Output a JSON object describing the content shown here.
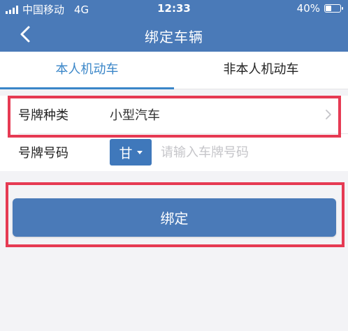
{
  "status_bar": {
    "carrier": "中国移动",
    "network": "4G",
    "time": "12:33",
    "battery": "40%"
  },
  "nav": {
    "title": "绑定车辆",
    "back_icon": "chevron-left-icon"
  },
  "tabs": [
    {
      "label": "本人机动车",
      "active": true
    },
    {
      "label": "非本人机动车",
      "active": false
    }
  ],
  "form": {
    "plate_type_label": "号牌种类",
    "plate_type_value": "小型汽车",
    "plate_number_label": "号牌号码",
    "province": "甘",
    "plate_placeholder": "请输入车牌号码"
  },
  "bind_button": "绑定",
  "colors": {
    "primary": "#4a7ab8",
    "tab_active": "#3a86c8",
    "highlight": "#e63a53",
    "background": "#f3f3f6"
  }
}
